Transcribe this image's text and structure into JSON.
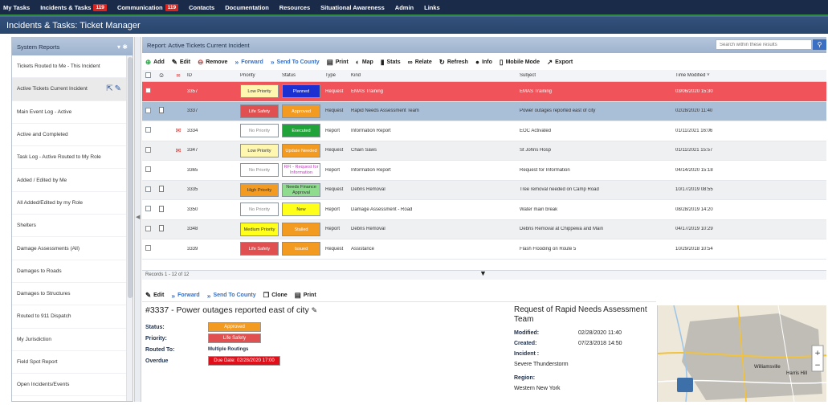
{
  "topnav": {
    "items": [
      {
        "label": "My Tasks"
      },
      {
        "label": "Incidents & Tasks",
        "badge": "119"
      },
      {
        "label": "Communication",
        "badge": "119"
      },
      {
        "label": "Contacts"
      },
      {
        "label": "Documentation"
      },
      {
        "label": "Resources"
      },
      {
        "label": "Situational Awareness"
      },
      {
        "label": "Admin"
      },
      {
        "label": "Links"
      }
    ]
  },
  "title": "Incidents & Tasks: Ticket Manager",
  "sidebar": {
    "header": "System Reports",
    "items": [
      {
        "label": "Tickets Routed to Me - This Incident"
      },
      {
        "label": "Active Tickets Current Incident"
      },
      {
        "label": "Main Event Log - Active"
      },
      {
        "label": "Active and Completed"
      },
      {
        "label": "Task Log - Active Routed to My Role"
      },
      {
        "label": "Added / Edited by Me"
      },
      {
        "label": "All Added/Edited by my Role"
      },
      {
        "label": "Shelters"
      },
      {
        "label": "Damage Assessments (All)"
      },
      {
        "label": "Damages to Roads"
      },
      {
        "label": "Damages to Structures"
      },
      {
        "label": "Routed to 911 Dispatch"
      },
      {
        "label": "My Jurisdiction"
      },
      {
        "label": "Field Spot Report"
      },
      {
        "label": "Open Incidents/Events"
      }
    ]
  },
  "report": {
    "header": "Report: Active Tickets Current Incident",
    "toolbar": [
      {
        "label": "Add",
        "icon": "plus-circle-icon",
        "sym": "⊕"
      },
      {
        "label": "Edit",
        "icon": "edit-icon",
        "sym": "✎"
      },
      {
        "label": "Remove",
        "icon": "remove-icon",
        "sym": "⊖"
      },
      {
        "label": "Forward",
        "icon": "forward-icon",
        "sym": "»",
        "blue": true
      },
      {
        "label": "Send To County",
        "icon": "send-icon",
        "sym": "»",
        "blue": true
      },
      {
        "label": "Print",
        "icon": "print-icon",
        "sym": "▤"
      },
      {
        "label": "Map",
        "icon": "map-icon",
        "sym": "◐"
      },
      {
        "label": "Stats",
        "icon": "stats-icon",
        "sym": "▮"
      },
      {
        "label": "Relate",
        "icon": "relate-icon",
        "sym": "∞"
      },
      {
        "label": "Refresh",
        "icon": "refresh-icon",
        "sym": "↻"
      },
      {
        "label": "Info",
        "icon": "info-icon",
        "sym": "●"
      },
      {
        "label": "Mobile Mode",
        "icon": "mobile-icon",
        "sym": "▯"
      },
      {
        "label": "Export",
        "icon": "export-icon",
        "sym": "↗"
      }
    ],
    "search_placeholder": "Search within these results",
    "columns": {
      "id": "ID",
      "priority": "Priority",
      "status": "Status",
      "type": "Type",
      "kind": "Kind",
      "subject": "Subject",
      "time": "Time Modified"
    },
    "rows": [
      {
        "id": "3357",
        "priority": "Low Priority",
        "pri_bg": "#fff7b0",
        "pri_fg": "#333",
        "status": "Planned",
        "stat_bg": "#1c2fd0",
        "stat_fg": "#fff",
        "type": "Request",
        "kind": "EMAS Training",
        "subject": "EMAS Training",
        "time": "03/06/2020 15:30",
        "style": "red",
        "doc": false,
        "mail": false
      },
      {
        "id": "3337",
        "priority": "Life Safety",
        "pri_bg": "#e05050",
        "pri_fg": "#fff",
        "status": "Approved",
        "stat_bg": "#f39a21",
        "stat_fg": "#fff",
        "type": "Request",
        "kind": "Rapid Needs Assessment Team",
        "subject": "Power outages reported east of city",
        "time": "02/28/2020 11:40",
        "style": "blue",
        "doc": true,
        "mail": false
      },
      {
        "id": "3334",
        "priority": "No Priority",
        "pri_bg": "#ffffff",
        "pri_fg": "#888",
        "status": "Executed",
        "stat_bg": "#21a33a",
        "stat_fg": "#fff",
        "type": "Report",
        "kind": "Information Report",
        "subject": "EOC Activated",
        "time": "01/11/2021 16:06",
        "style": "",
        "doc": false,
        "mail": true
      },
      {
        "id": "3347",
        "priority": "Low Priority",
        "pri_bg": "#fff7b0",
        "pri_fg": "#333",
        "status": "Update Needed",
        "stat_bg": "#f39a21",
        "stat_fg": "#fff",
        "type": "Request",
        "kind": "Chain Saws",
        "subject": "St Johns Hosp",
        "time": "01/11/2021 15:57",
        "style": "alt",
        "doc": false,
        "mail": true
      },
      {
        "id": "3365",
        "priority": "No Priority",
        "pri_bg": "#ffffff",
        "pri_fg": "#888",
        "status": "RFI - Request for Information",
        "stat_bg": "#ffffff",
        "stat_fg": "#c040c0",
        "type": "Report",
        "kind": "Information Report",
        "subject": "Request for Information",
        "time": "04/14/2020 15:18",
        "style": "",
        "doc": false,
        "mail": false
      },
      {
        "id": "3335",
        "priority": "High Priority",
        "pri_bg": "#f39a21",
        "pri_fg": "#333",
        "status": "Needs Finance Approval",
        "stat_bg": "#8fdc8f",
        "stat_fg": "#333",
        "type": "Request",
        "kind": "Debris Removal",
        "subject": "Tree removal needed on Camp Road",
        "time": "10/17/2019 08:55",
        "style": "alt",
        "doc": true,
        "mail": false
      },
      {
        "id": "3350",
        "priority": "No Priority",
        "pri_bg": "#ffffff",
        "pri_fg": "#888",
        "status": "New",
        "stat_bg": "#ffff1a",
        "stat_fg": "#333",
        "type": "Report",
        "kind": "Damage Assessment - Road",
        "subject": "Water main break",
        "time": "08/28/2019 14:20",
        "style": "",
        "doc": true,
        "mail": false
      },
      {
        "id": "3348",
        "priority": "Medium Priority",
        "pri_bg": "#ffff1a",
        "pri_fg": "#333",
        "status": "Stalled",
        "stat_bg": "#f39a21",
        "stat_fg": "#fff",
        "type": "Report",
        "kind": "Debris Removal",
        "subject": "Debris Removal at Chippewa and Main",
        "time": "04/17/2019 10:29",
        "style": "alt",
        "doc": true,
        "mail": false
      },
      {
        "id": "3339",
        "priority": "Life Safety",
        "pri_bg": "#e05050",
        "pri_fg": "#fff",
        "status": "Issued",
        "stat_bg": "#f39a21",
        "stat_fg": "#fff",
        "type": "Request",
        "kind": "Assistance",
        "subject": "Flash Flooding on Route 5",
        "time": "10/29/2018 10:54",
        "style": "",
        "doc": false,
        "mail": false
      }
    ],
    "records": "Records 1 - 12 of 12"
  },
  "detail": {
    "toolbar": [
      {
        "label": "Edit",
        "sym": "✎"
      },
      {
        "label": "Forward",
        "sym": "»",
        "blue": true
      },
      {
        "label": "Send To County",
        "sym": "»",
        "blue": true
      },
      {
        "label": "Clone",
        "sym": "❐"
      },
      {
        "label": "Print",
        "sym": "▤"
      }
    ],
    "title": "#3337 - Power outages reported east of city",
    "status_label": "Status:",
    "status": "Approved",
    "priority_label": "Priority:",
    "priority": "Life Safety",
    "routed_label": "Routed To:",
    "routed": "Multiple Routings",
    "overdue_label": "Overdue",
    "overdue": "Due Date: 02/28/2020 17:00",
    "right_title": "Request of Rapid Needs Assessment Team",
    "modified_label": "Modified:",
    "modified": "02/28/2020 11:40",
    "created_label": "Created:",
    "created": "07/23/2018 14:50",
    "incident_label": "Incident :",
    "incident": "Severe Thunderstorm",
    "region_label": "Region:",
    "region": "Western New York"
  },
  "map": {
    "labels": [
      "Williamsville",
      "Harris Hill"
    ]
  }
}
